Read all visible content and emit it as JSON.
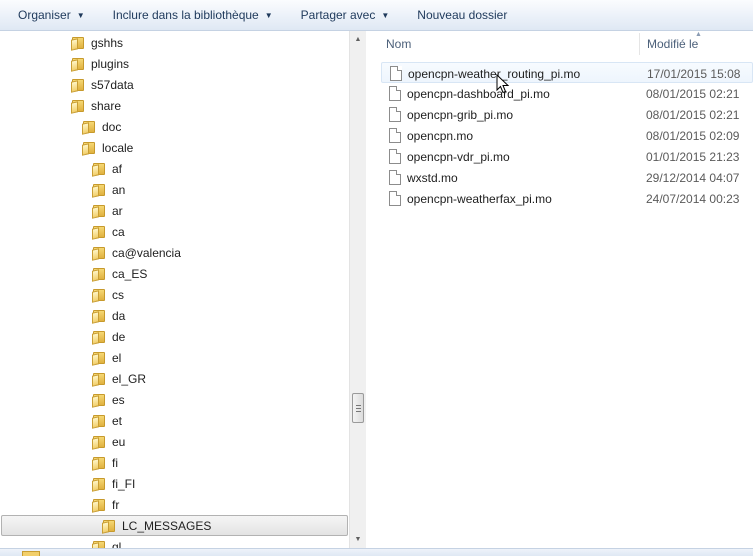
{
  "toolbar": {
    "organize_label": "Organiser",
    "include_label": "Inclure dans la bibliothèque",
    "share_label": "Partager avec",
    "new_folder_label": "Nouveau dossier"
  },
  "tree": {
    "items": [
      {
        "label": "gshhs"
      },
      {
        "label": "plugins"
      },
      {
        "label": "s57data"
      },
      {
        "label": "share"
      },
      {
        "label": "doc"
      },
      {
        "label": "locale"
      },
      {
        "label": "af"
      },
      {
        "label": "an"
      },
      {
        "label": "ar"
      },
      {
        "label": "ca"
      },
      {
        "label": "ca@valencia"
      },
      {
        "label": "ca_ES"
      },
      {
        "label": "cs"
      },
      {
        "label": "da"
      },
      {
        "label": "de"
      },
      {
        "label": "el"
      },
      {
        "label": "el_GR"
      },
      {
        "label": "es"
      },
      {
        "label": "et"
      },
      {
        "label": "eu"
      },
      {
        "label": "fi"
      },
      {
        "label": "fi_FI"
      },
      {
        "label": "fr"
      },
      {
        "label": "LC_MESSAGES"
      },
      {
        "label": "gl"
      }
    ],
    "selected_label": "LC_MESSAGES"
  },
  "list": {
    "columns": {
      "name": "Nom",
      "modified": "Modifié le"
    },
    "files": [
      {
        "name": "opencpn-weather_routing_pi.mo",
        "modified": "17/01/2015 15:08"
      },
      {
        "name": "opencpn-dashboard_pi.mo",
        "modified": "08/01/2015 02:21"
      },
      {
        "name": "opencpn-grib_pi.mo",
        "modified": "08/01/2015 02:21"
      },
      {
        "name": "opencpn.mo",
        "modified": "08/01/2015 02:09"
      },
      {
        "name": "opencpn-vdr_pi.mo",
        "modified": "01/01/2015 21:23"
      },
      {
        "name": "wxstd.mo",
        "modified": "29/12/2014 04:07"
      },
      {
        "name": "opencpn-weatherfax_pi.mo",
        "modified": "24/07/2014 00:23"
      }
    ],
    "hovered_file": "opencpn-weather_routing_pi.mo"
  },
  "icons": {
    "folder": "folder-icon",
    "file": "document-icon",
    "dropdown": "chevron-down-icon",
    "scroll_up": "arrow-up-icon",
    "scroll_down": "arrow-down-icon",
    "cursor": "mouse-pointer-icon"
  },
  "colors": {
    "toolbar_text": "#1e395b",
    "header_text": "#4c607a",
    "folder_yellow": "#f2cf6b",
    "hover_fill": "#eef5fd"
  }
}
